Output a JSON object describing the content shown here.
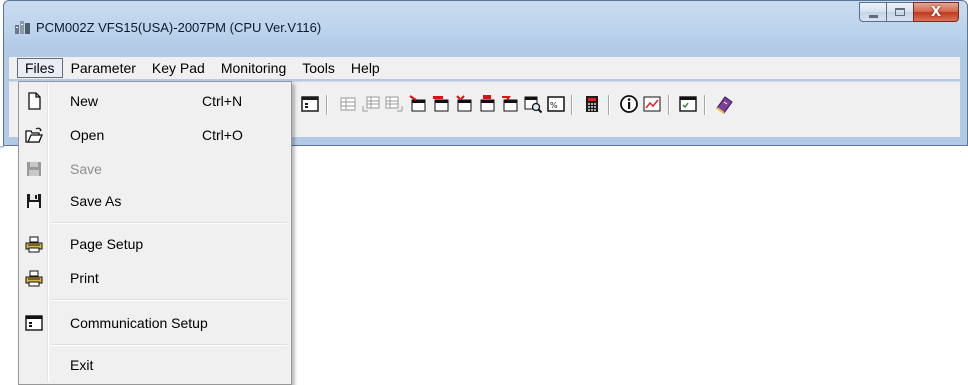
{
  "window": {
    "title": "PCM002Z VFS15(USA)-2007PM (CPU Ver.V116)",
    "controls": {
      "minimize": "minimize-icon",
      "maximize": "maximize-icon",
      "close": "X"
    }
  },
  "menubar": {
    "items": [
      {
        "label": "Files",
        "active": true
      },
      {
        "label": "Parameter"
      },
      {
        "label": "Key Pad"
      },
      {
        "label": "Monitoring"
      },
      {
        "label": "Tools"
      },
      {
        "label": "Help"
      }
    ]
  },
  "toolbar": {
    "icons": [
      "communication-setup-icon",
      "grid-icon",
      "grid-read-icon",
      "grid-write-icon",
      "param-table-icon-1",
      "param-table-icon-2",
      "param-table-icon-3",
      "param-table-icon-4",
      "param-table-icon-5",
      "search-table-icon",
      "percent-icon",
      "keypad-icon",
      "info-icon",
      "chart-icon",
      "window-check-icon",
      "book-icon"
    ]
  },
  "files_menu": {
    "items": [
      {
        "label": "New",
        "shortcut": "Ctrl+N",
        "icon": "new-file-icon",
        "enabled": true
      },
      {
        "label": "Open",
        "shortcut": "Ctrl+O",
        "icon": "open-folder-icon",
        "enabled": true
      },
      {
        "label": "Save",
        "shortcut": "",
        "icon": "save-disk-icon",
        "enabled": false
      },
      {
        "label": "Save As",
        "shortcut": "",
        "icon": "save-as-disk-icon",
        "enabled": true
      },
      {
        "label": "Page Setup",
        "shortcut": "",
        "icon": "page-setup-printer-icon",
        "enabled": true
      },
      {
        "label": "Print",
        "shortcut": "",
        "icon": "printer-icon",
        "enabled": true
      },
      {
        "label": "Communication Setup",
        "shortcut": "",
        "icon": "communication-setup-icon",
        "enabled": true
      },
      {
        "label": "Exit",
        "shortcut": "",
        "icon": "",
        "enabled": true
      }
    ]
  },
  "colors": {
    "titlebar": "#bcd3ec",
    "menu_background": "#f0f0f0",
    "disabled_text": "#8d8d8d",
    "close_button": "#c0391b"
  }
}
